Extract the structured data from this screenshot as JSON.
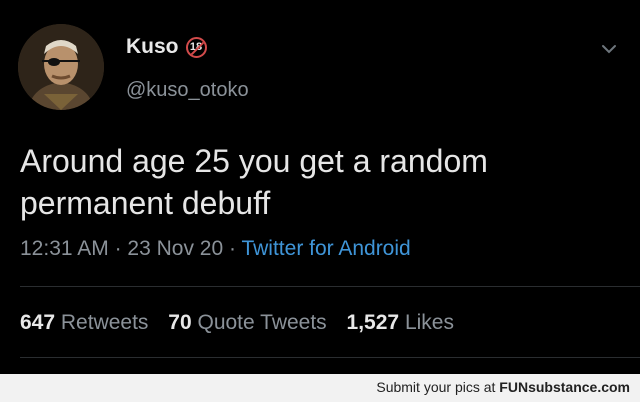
{
  "tweet": {
    "display_name": "Kuso",
    "badge": "18",
    "handle": "@kuso_otoko",
    "text_line1": "Around age 25 you get a random",
    "text_line2": "permanent debuff",
    "time": "12:31 AM",
    "date": "23 Nov 20",
    "separator": "·",
    "source": "Twitter for Android",
    "retweets_count": "647",
    "retweets_label": "Retweets",
    "quote_count": "70",
    "quote_label": "Quote Tweets",
    "likes_count": "1,527",
    "likes_label": "Likes"
  },
  "footer": {
    "prefix": "Submit your pics at ",
    "brand": "FUNsubstance.com"
  },
  "colors": {
    "background": "#000000",
    "link": "#3f95d8",
    "muted": "#8b9299"
  },
  "icons": {
    "menu": "chevron-down-icon",
    "badge": "age-restriction-icon"
  }
}
